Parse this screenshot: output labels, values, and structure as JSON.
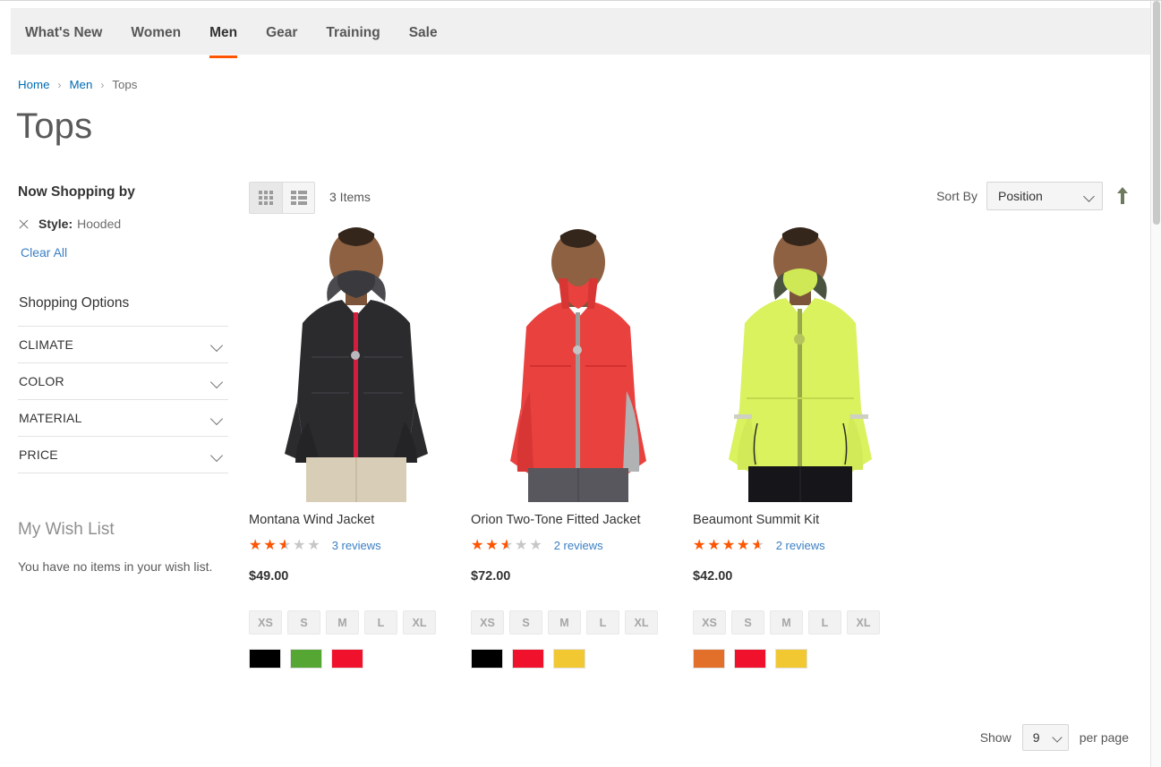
{
  "nav": {
    "items": [
      {
        "label": "What's New",
        "active": false
      },
      {
        "label": "Women",
        "active": false
      },
      {
        "label": "Men",
        "active": true
      },
      {
        "label": "Gear",
        "active": false
      },
      {
        "label": "Training",
        "active": false
      },
      {
        "label": "Sale",
        "active": false
      }
    ]
  },
  "breadcrumbs": {
    "home": "Home",
    "men": "Men",
    "current": "Tops",
    "separator": "›"
  },
  "page_title": "Tops",
  "sidebar": {
    "now_shopping_by": "Now Shopping by",
    "active_filter": {
      "label": "Style:",
      "value": "Hooded"
    },
    "clear_all": "Clear All",
    "shopping_options": "Shopping Options",
    "options": [
      {
        "name": "CLIMATE"
      },
      {
        "name": "COLOR"
      },
      {
        "name": "MATERIAL"
      },
      {
        "name": "PRICE"
      }
    ],
    "wish_list_title": "My Wish List",
    "wish_list_empty": "You have no items in your wish list."
  },
  "toolbar": {
    "grid_mode": "grid-mode",
    "list_mode": "list-mode",
    "items_count": "3 Items",
    "sort_label": "Sort By",
    "sort_value": "Position",
    "sort_direction": "ascending"
  },
  "products": [
    {
      "name": "Montana Wind Jacket",
      "rating_percent": 50,
      "reviews": "3 reviews",
      "price": "$49.00",
      "sizes": [
        "XS",
        "S",
        "M",
        "L",
        "XL"
      ],
      "colors": [
        "#000000",
        "#55a633",
        "#f0122c"
      ],
      "image": {
        "jacket": "#2b2b2e",
        "zipper": "#d21e3c",
        "pants": "#d8cdb6",
        "hood": "#8e9296"
      }
    },
    {
      "name": "Orion Two-Tone Fitted Jacket",
      "rating_percent": 50,
      "reviews": "2 reviews",
      "price": "$72.00",
      "sizes": [
        "XS",
        "S",
        "M",
        "L",
        "XL"
      ],
      "colors": [
        "#000000",
        "#f0122c",
        "#f2c832"
      ],
      "image": {
        "jacket": "#e8413e",
        "zipper": "#9b9b9b",
        "pants": "#57575d",
        "hood": "#b4b4b4"
      }
    },
    {
      "name": "Beaumont Summit Kit",
      "rating_percent": 90,
      "reviews": "2 reviews",
      "price": "$42.00",
      "sizes": [
        "XS",
        "S",
        "M",
        "L",
        "XL"
      ],
      "colors": [
        "#e2702a",
        "#f0122c",
        "#f2c832"
      ],
      "image": {
        "jacket": "#d9f25e",
        "zipper": "#9aa84a",
        "pants": "#16161a",
        "hood": "#4a5340"
      }
    }
  ],
  "bottom": {
    "show_label": "Show",
    "per_page_value": "9",
    "per_page_label": "per page"
  },
  "stars_glyph": "★★★★★"
}
